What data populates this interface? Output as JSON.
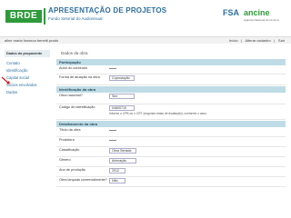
{
  "header": {
    "logo": "BRDE",
    "title": "APRESENTAÇÃO DE PROJETOS",
    "subtitle": "Fundo Setorial do Audiovisual",
    "right_logo_1": "FSA",
    "right_logo_2": "ancine",
    "right_logo_2_sub": "Agência Nacional do Cinema"
  },
  "userbar": {
    "user": "aline maria fonseca benetti prado",
    "links": [
      "Início",
      "Alterar cadastro",
      "Sair"
    ]
  },
  "sidebar": {
    "title": "Dados do proponente",
    "items": [
      "Contato",
      "Identificação",
      "Capital social",
      "Sócios envolvidos",
      "Dados"
    ]
  },
  "main": {
    "title": "Dados da obra",
    "sections": [
      {
        "label": "Participação",
        "rows": [
          {
            "label": "Autor do conteúdo",
            "value": "—"
          },
          {
            "label": "Forma de atuação na obra",
            "value": "Coprodução"
          }
        ]
      },
      {
        "label": "Identificação da obra",
        "rows": [
          {
            "label": "Obra nacional?",
            "value": "Sim"
          },
          {
            "label": "Código de identificação",
            "value": "04600710",
            "help": "Informe o CPB ou o CRT (segundo estas de Avaliação), conforme o caso."
          }
        ]
      },
      {
        "label": "Detalhamento da obra",
        "rows": [
          {
            "label": "Título da obra",
            "value": "—"
          },
          {
            "label": "Produtora",
            "value": "—"
          },
          {
            "label": "Classificação",
            "value": "Obra Seriada"
          },
          {
            "label": "Gênero",
            "value": "Animação"
          },
          {
            "label": "Ano de produção",
            "value": "2012"
          },
          {
            "label": "Obra lançada comercialmente?",
            "value": "Não"
          }
        ]
      }
    ]
  },
  "colors": {
    "brand_green": "#2e9a3a",
    "brand_blue": "#2e6f9e",
    "section_bg": "#bfdce6",
    "annotation_arrow": "#d01818"
  }
}
